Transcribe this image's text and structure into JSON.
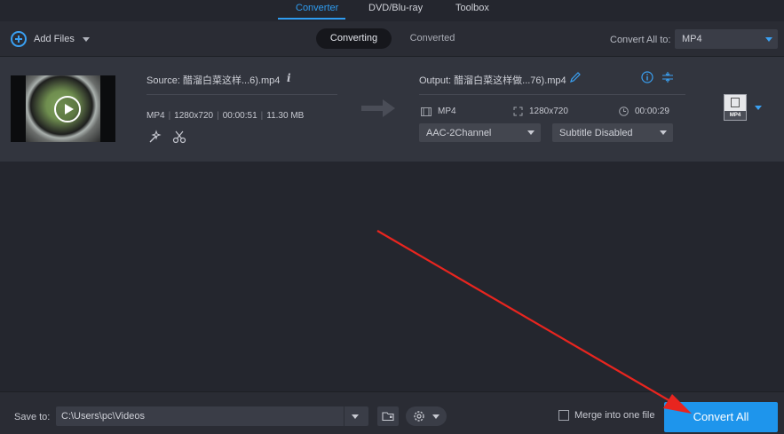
{
  "top_tabs": {
    "converter": "Converter",
    "dvd": "DVD/Blu-ray",
    "toolbox": "Toolbox"
  },
  "toolbar": {
    "add_files": "Add Files",
    "converting": "Converting",
    "converted": "Converted",
    "convert_all_to_label": "Convert All to:",
    "convert_all_to_value": "MP4"
  },
  "file": {
    "source": "Source: 醋溜白菜这样...6).mp4",
    "format": "MP4",
    "resolution": "1280x720",
    "duration": "00:00:51",
    "size": "11.30 MB",
    "output": "Output: 醋溜白菜这样做...76).mp4",
    "out_format": "MP4",
    "out_resolution": "1280x720",
    "out_duration": "00:00:29",
    "audio": "AAC-2Channel",
    "subtitle": "Subtitle Disabled",
    "format_badge": "MP4"
  },
  "bottom": {
    "save_to_label": "Save to:",
    "save_path": "C:\\Users\\pc\\Videos",
    "merge_label": "Merge into one file",
    "convert_all": "Convert All"
  },
  "colors": {
    "accent": "#1e95ec",
    "annotation_arrow": "#e8251f"
  }
}
